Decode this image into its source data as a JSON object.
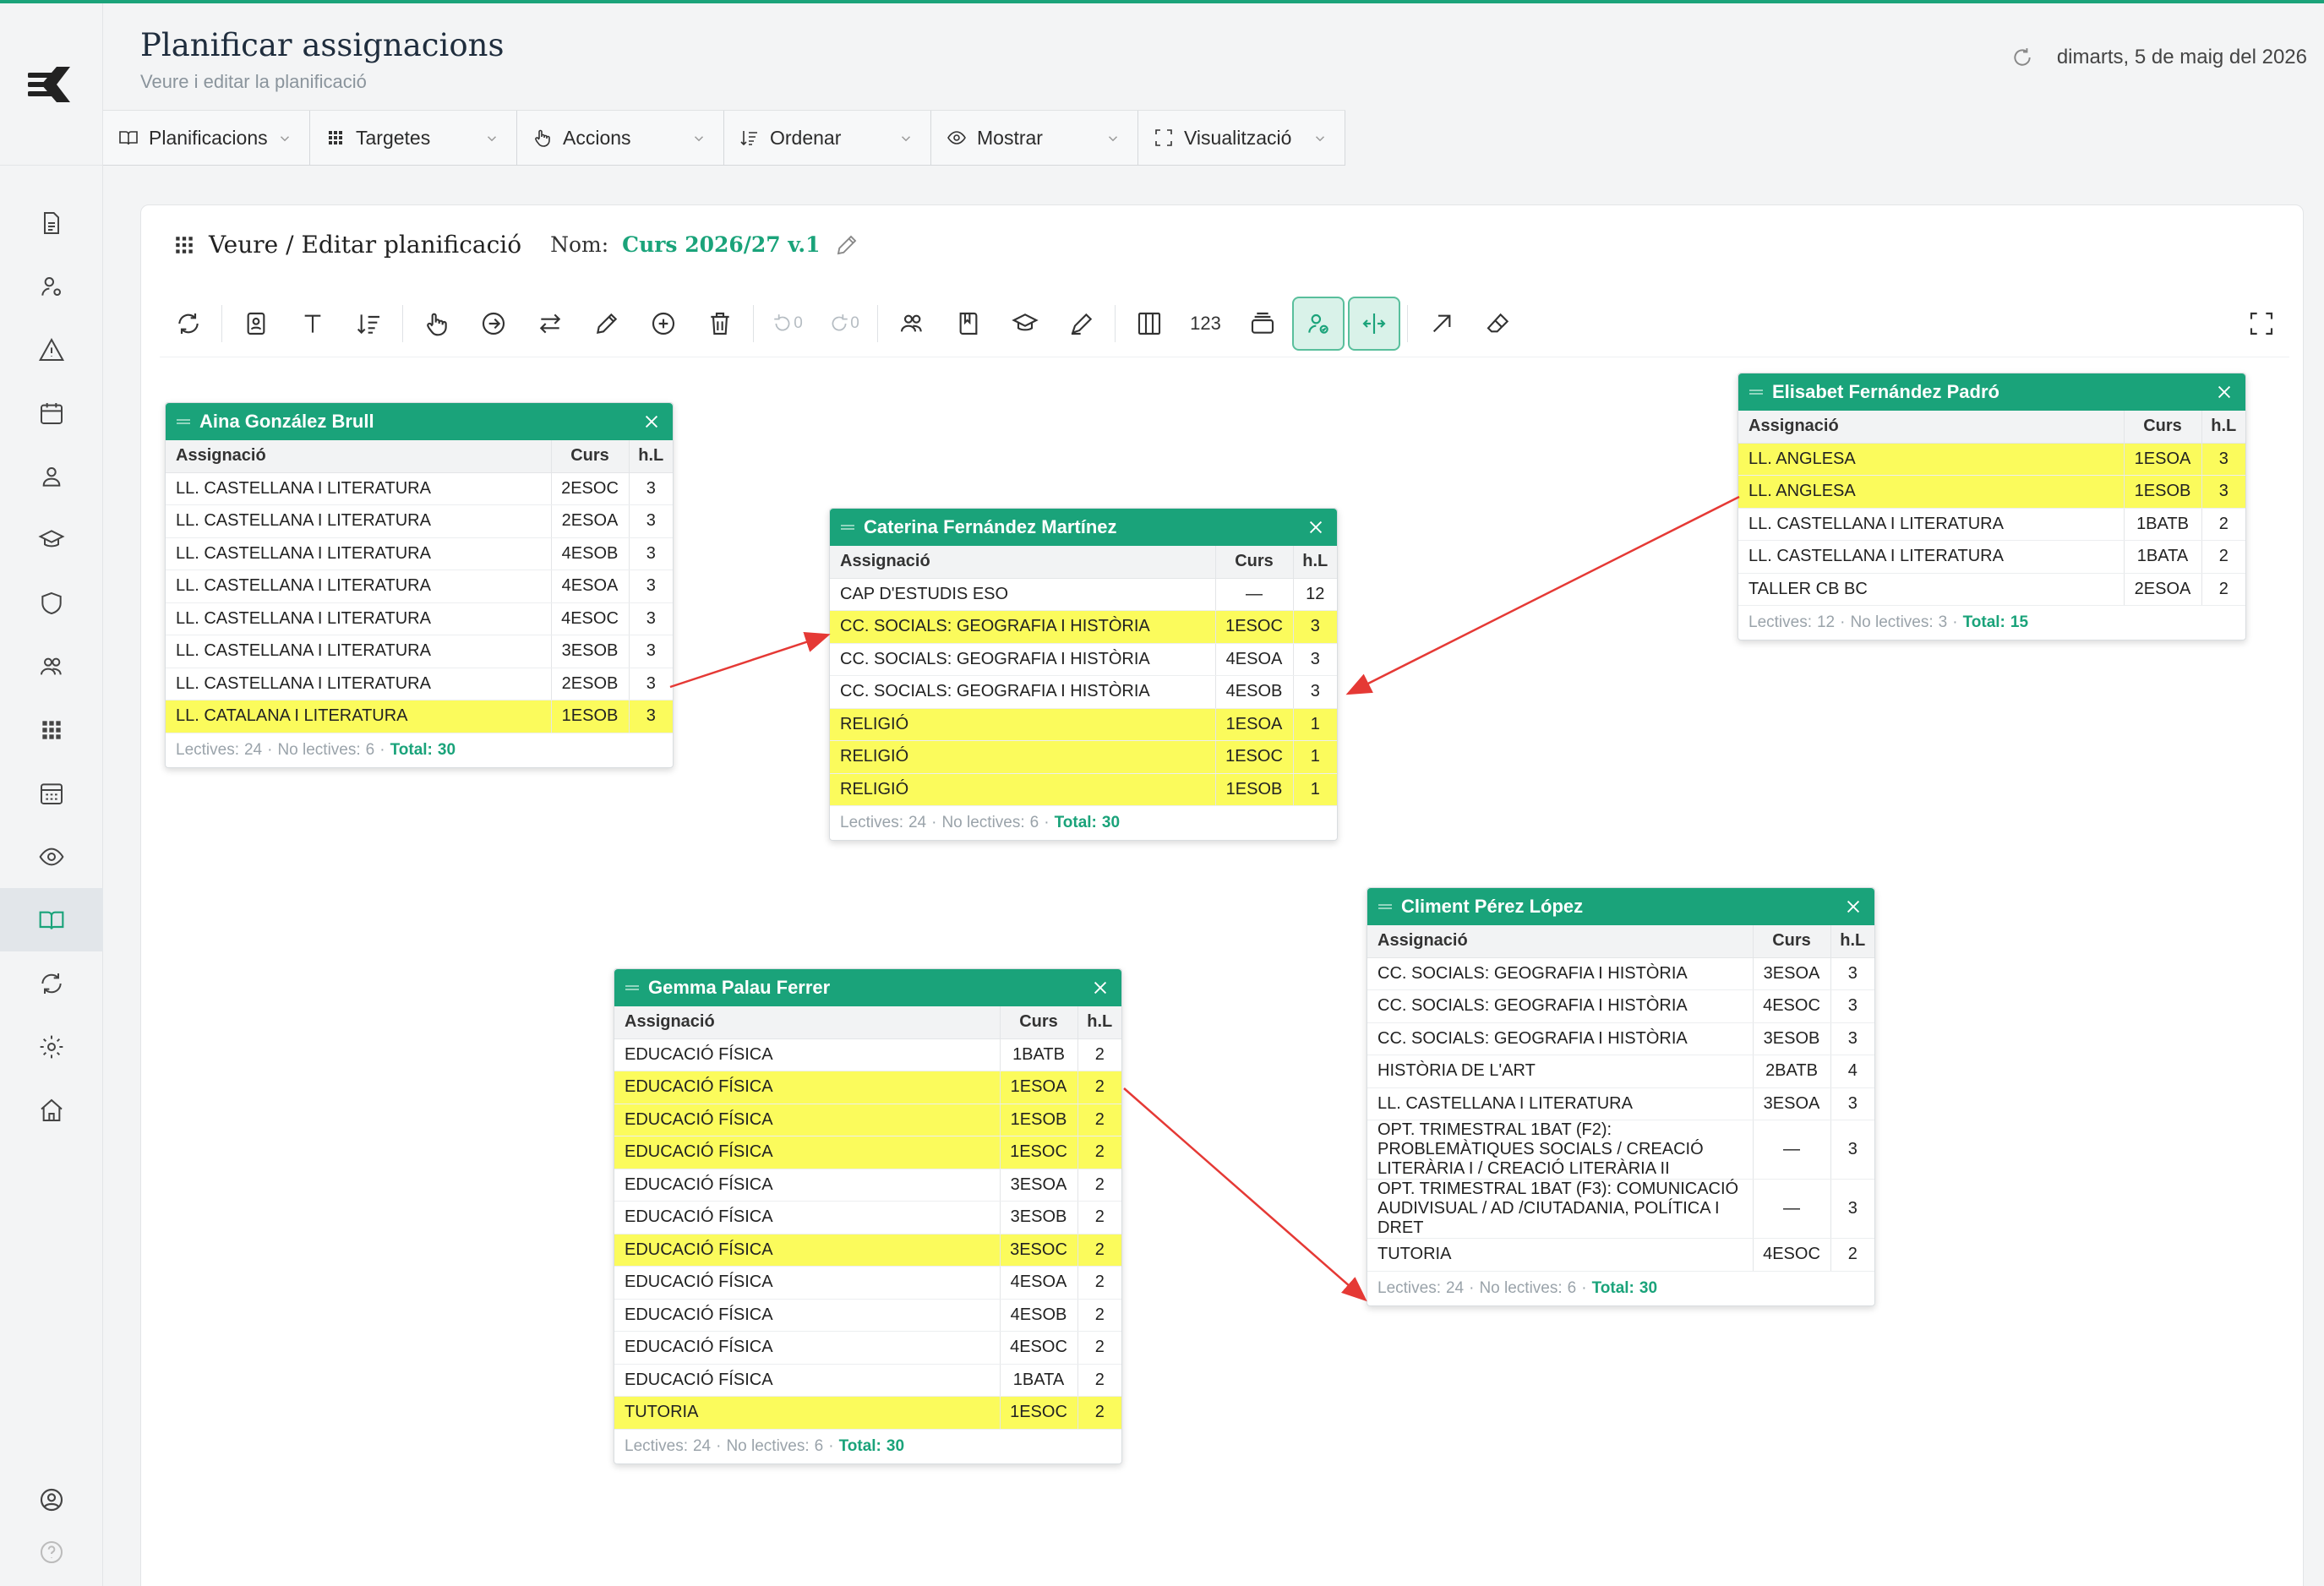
{
  "header": {
    "title": "Planificar assignacions",
    "subtitle": "Veure i editar la planificació",
    "date": "dimarts, 5 de maig del 2026"
  },
  "menubar": [
    {
      "label": "Planificacions",
      "icon": "book-icon"
    },
    {
      "label": "Targetes",
      "icon": "grid-icon"
    },
    {
      "label": "Accions",
      "icon": "hand-icon"
    },
    {
      "label": "Ordenar",
      "icon": "sort-icon"
    },
    {
      "label": "Mostrar",
      "icon": "eye-icon"
    },
    {
      "label": "Visualització",
      "icon": "expand-icon"
    }
  ],
  "panel": {
    "title": "Veure / Editar planificació",
    "nom_label": "Nom:",
    "nom_value": "Curs 2026/27 v.1"
  },
  "toolbar": {
    "undo_count": "0",
    "redo_count": "0",
    "numbers_label": "123"
  },
  "columns": {
    "subject": "Assignació",
    "course": "Curs",
    "hours": "h.L"
  },
  "footer_labels": {
    "lectives": "Lectives:",
    "no_lectives": "No lectives:",
    "total": "Total:"
  },
  "cards": [
    {
      "name": "Aina González Brull",
      "rows": [
        {
          "subject": "LL. CASTELLANA I LITERATURA",
          "course": "2ESOC",
          "hours": "3",
          "hl": false
        },
        {
          "subject": "LL. CASTELLANA I LITERATURA",
          "course": "2ESOA",
          "hours": "3",
          "hl": false
        },
        {
          "subject": "LL. CASTELLANA I LITERATURA",
          "course": "4ESOB",
          "hours": "3",
          "hl": false
        },
        {
          "subject": "LL. CASTELLANA I LITERATURA",
          "course": "4ESOA",
          "hours": "3",
          "hl": false
        },
        {
          "subject": "LL. CASTELLANA I LITERATURA",
          "course": "4ESOC",
          "hours": "3",
          "hl": false
        },
        {
          "subject": "LL. CASTELLANA I LITERATURA",
          "course": "3ESOB",
          "hours": "3",
          "hl": false
        },
        {
          "subject": "LL. CASTELLANA I LITERATURA",
          "course": "2ESOB",
          "hours": "3",
          "hl": false
        },
        {
          "subject": "LL. CATALANA I LITERATURA",
          "course": "1ESOB",
          "hours": "3",
          "hl": true
        }
      ],
      "lectives": "24",
      "no_lectives": "6",
      "total": "30"
    },
    {
      "name": "Caterina Fernández Martínez",
      "rows": [
        {
          "subject": "CAP D'ESTUDIS ESO",
          "course": "—",
          "hours": "12",
          "hl": false
        },
        {
          "subject": "CC. SOCIALS: GEOGRAFIA I HISTÒRIA",
          "course": "1ESOC",
          "hours": "3",
          "hl": true
        },
        {
          "subject": "CC. SOCIALS: GEOGRAFIA I HISTÒRIA",
          "course": "4ESOA",
          "hours": "3",
          "hl": false
        },
        {
          "subject": "CC. SOCIALS: GEOGRAFIA I HISTÒRIA",
          "course": "4ESOB",
          "hours": "3",
          "hl": false
        },
        {
          "subject": "RELIGIÓ",
          "course": "1ESOA",
          "hours": "1",
          "hl": true
        },
        {
          "subject": "RELIGIÓ",
          "course": "1ESOC",
          "hours": "1",
          "hl": true
        },
        {
          "subject": "RELIGIÓ",
          "course": "1ESOB",
          "hours": "1",
          "hl": true
        }
      ],
      "lectives": "24",
      "no_lectives": "6",
      "total": "30"
    },
    {
      "name": "Elisabet Fernández Padró",
      "rows": [
        {
          "subject": "LL. ANGLESA",
          "course": "1ESOA",
          "hours": "3",
          "hl": true
        },
        {
          "subject": "LL. ANGLESA",
          "course": "1ESOB",
          "hours": "3",
          "hl": true
        },
        {
          "subject": "LL. CASTELLANA I LITERATURA",
          "course": "1BATB",
          "hours": "2",
          "hl": false
        },
        {
          "subject": "LL. CASTELLANA I LITERATURA",
          "course": "1BATA",
          "hours": "2",
          "hl": false
        },
        {
          "subject": "TALLER CB BC",
          "course": "2ESOA",
          "hours": "2",
          "hl": false
        }
      ],
      "lectives": "12",
      "no_lectives": "3",
      "total": "15"
    },
    {
      "name": "Climent Pérez López",
      "rows": [
        {
          "subject": "CC. SOCIALS: GEOGRAFIA I HISTÒRIA",
          "course": "3ESOA",
          "hours": "3",
          "hl": false
        },
        {
          "subject": "CC. SOCIALS: GEOGRAFIA I HISTÒRIA",
          "course": "4ESOC",
          "hours": "3",
          "hl": false
        },
        {
          "subject": "CC. SOCIALS: GEOGRAFIA I HISTÒRIA",
          "course": "3ESOB",
          "hours": "3",
          "hl": false
        },
        {
          "subject": "HISTÒRIA DE L'ART",
          "course": "2BATB",
          "hours": "4",
          "hl": false
        },
        {
          "subject": "LL. CASTELLANA I LITERATURA",
          "course": "3ESOA",
          "hours": "3",
          "hl": false
        },
        {
          "subject": "OPT. TRIMESTRAL 1BAT (F2): PROBLEMÀTIQUES SOCIALS / CREACIÓ LITERÀRIA I / CREACIÓ LITERÀRIA II",
          "course": "—",
          "hours": "3",
          "hl": false
        },
        {
          "subject": "OPT. TRIMESTRAL 1BAT (F3): COMUNICACIÓ AUDIVISUAL / AD /CIUTADANIA, POLÍTICA I DRET",
          "course": "—",
          "hours": "3",
          "hl": false
        },
        {
          "subject": "TUTORIA",
          "course": "4ESOC",
          "hours": "2",
          "hl": false
        }
      ],
      "lectives": "24",
      "no_lectives": "6",
      "total": "30"
    },
    {
      "name": "Gemma Palau Ferrer",
      "rows": [
        {
          "subject": "EDUCACIÓ FÍSICA",
          "course": "1BATB",
          "hours": "2",
          "hl": false
        },
        {
          "subject": "EDUCACIÓ FÍSICA",
          "course": "1ESOA",
          "hours": "2",
          "hl": true
        },
        {
          "subject": "EDUCACIÓ FÍSICA",
          "course": "1ESOB",
          "hours": "2",
          "hl": true
        },
        {
          "subject": "EDUCACIÓ FÍSICA",
          "course": "1ESOC",
          "hours": "2",
          "hl": true
        },
        {
          "subject": "EDUCACIÓ FÍSICA",
          "course": "3ESOA",
          "hours": "2",
          "hl": false
        },
        {
          "subject": "EDUCACIÓ FÍSICA",
          "course": "3ESOB",
          "hours": "2",
          "hl": false
        },
        {
          "subject": "EDUCACIÓ FÍSICA",
          "course": "3ESOC",
          "hours": "2",
          "hl": true
        },
        {
          "subject": "EDUCACIÓ FÍSICA",
          "course": "4ESOA",
          "hours": "2",
          "hl": false
        },
        {
          "subject": "EDUCACIÓ FÍSICA",
          "course": "4ESOB",
          "hours": "2",
          "hl": false
        },
        {
          "subject": "EDUCACIÓ FÍSICA",
          "course": "4ESOC",
          "hours": "2",
          "hl": false
        },
        {
          "subject": "EDUCACIÓ FÍSICA",
          "course": "1BATA",
          "hours": "2",
          "hl": false
        },
        {
          "subject": "TUTORIA",
          "course": "1ESOC",
          "hours": "2",
          "hl": true
        }
      ],
      "lectives": "24",
      "no_lectives": "6",
      "total": "30"
    }
  ],
  "colors": {
    "accent": "#1aa37a",
    "highlight": "#fbfb5c",
    "arrow": "#e53935"
  }
}
